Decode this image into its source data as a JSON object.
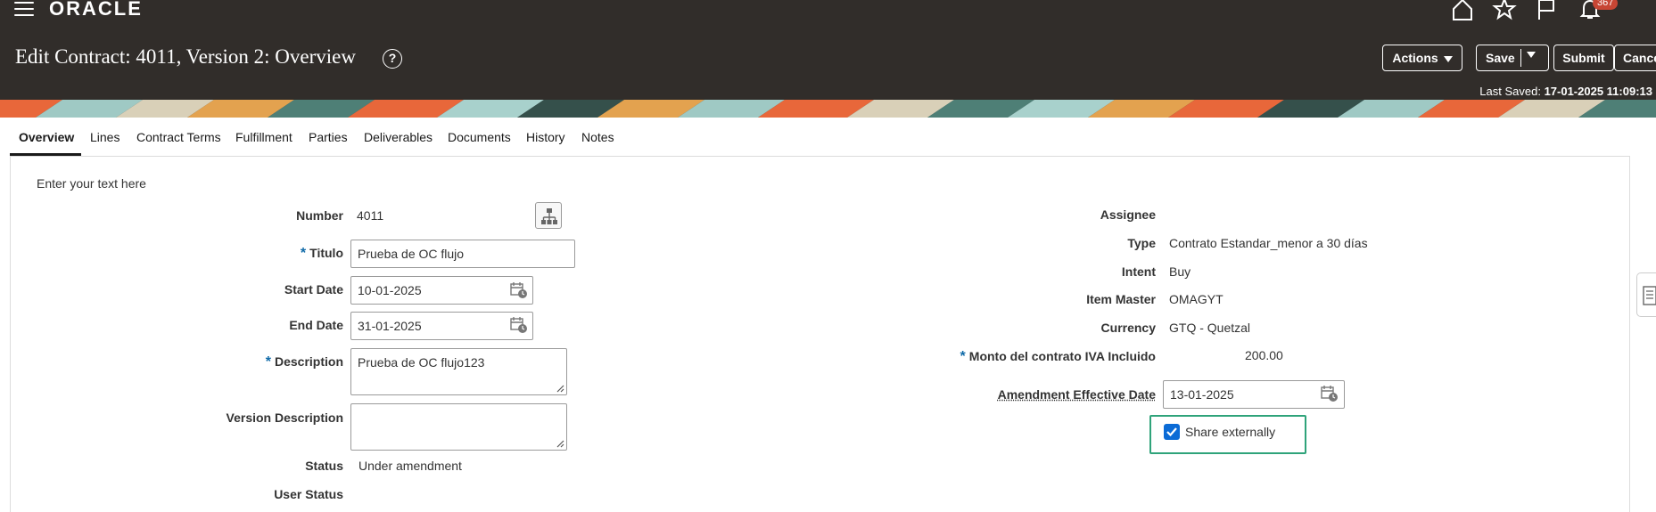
{
  "header": {
    "logo": "ORACLE",
    "notification_count": "367",
    "title": "Edit Contract: 4011, Version 2: Overview",
    "help_glyph": "?",
    "buttons": {
      "actions": "Actions",
      "save": "Save",
      "submit": "Submit",
      "cancel": "Cancel"
    },
    "last_saved_label": "Last Saved:",
    "last_saved_value": "17-01-2025 11:09:13"
  },
  "tabs": [
    "Overview",
    "Lines",
    "Contract Terms",
    "Fulfillment",
    "Parties",
    "Deliverables",
    "Documents",
    "History",
    "Notes"
  ],
  "hint_text": "Enter your text here",
  "left_form": {
    "number_label": "Number",
    "number_value": "4011",
    "titulo_label": "Titulo",
    "titulo_value": "Prueba de OC flujo",
    "start_date_label": "Start Date",
    "start_date_value": "10-01-2025",
    "end_date_label": "End Date",
    "end_date_value": "31-01-2025",
    "description_label": "Description",
    "description_value": "Prueba de OC flujo123",
    "version_description_label": "Version Description",
    "version_description_value": "",
    "status_label": "Status",
    "status_value": "Under amendment",
    "user_status_label": "User Status"
  },
  "right_form": {
    "assignee_label": "Assignee",
    "assignee_value": "",
    "type_label": "Type",
    "type_value": "Contrato Estandar_menor a 30 días",
    "intent_label": "Intent",
    "intent_value": "Buy",
    "item_master_label": "Item Master",
    "item_master_value": "OMAGYT",
    "currency_label": "Currency",
    "currency_value": "GTQ - Quetzal",
    "monto_label": "Monto del contrato IVA Incluido",
    "monto_value": "200.00",
    "amendment_label": "Amendment Effective Date",
    "amendment_value": "13-01-2025",
    "share_label": "Share externally",
    "share_checked": true
  },
  "required_marker": "*",
  "colors": {
    "header_bg": "#312d2a",
    "accent_blue": "#0b6bd6",
    "highlight_green": "#2fa37a",
    "badge_red": "#c74634"
  },
  "icons": [
    "menu-icon",
    "home-icon",
    "star-icon",
    "flag-icon",
    "bell-icon",
    "help-icon",
    "hierarchy-icon",
    "calendar-icon",
    "checkbox-icon",
    "panel-icon"
  ]
}
